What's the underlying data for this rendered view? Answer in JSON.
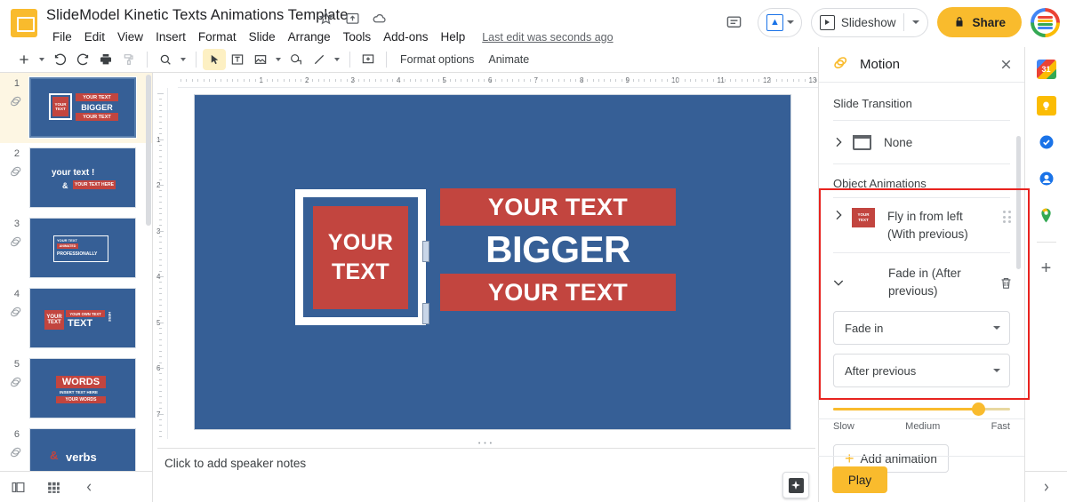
{
  "app": {
    "doc_title": "SlideModel Kinetic Texts Animations Template",
    "last_edit": "Last edit was seconds ago",
    "title_icons": [
      "star-icon",
      "move-to-folder-icon",
      "cloud-saved-icon"
    ]
  },
  "menus": [
    "File",
    "Edit",
    "View",
    "Insert",
    "Format",
    "Slide",
    "Arrange",
    "Tools",
    "Add-ons",
    "Help"
  ],
  "topright": {
    "comment_icon": "comment-icon",
    "present_icon": "present-icon",
    "slideshow_label": "Slideshow",
    "share_label": "Share",
    "share_lock_icon": "lock-icon",
    "avatar": "user-avatar"
  },
  "toolbar": {
    "new_slide_icon": "plus-icon",
    "undo_icon": "undo-icon",
    "redo_icon": "redo-icon",
    "print_icon": "print-icon",
    "paint_icon": "paint-format-icon",
    "zoom_icon": "zoom-icon",
    "select_icon": "select-cursor-icon",
    "textbox_icon": "text-box-icon",
    "image_icon": "image-icon",
    "shape_icon": "shape-icon",
    "line_icon": "line-icon",
    "comment_icon": "add-comment-icon",
    "format_options": "Format options",
    "animate": "Animate",
    "collapse_icon": "chevron-up-icon"
  },
  "ruler": {
    "horizontal": [
      "1",
      "2",
      "3",
      "4",
      "5",
      "6",
      "7",
      "8",
      "9",
      "10",
      "11",
      "12",
      "13"
    ],
    "vertical": [
      "1",
      "2",
      "3",
      "4",
      "5",
      "6",
      "7"
    ]
  },
  "filmstrip": {
    "slides": [
      {
        "num": "1",
        "selected": true,
        "badge": "animation-badge-icon",
        "kind": "s1"
      },
      {
        "num": "2",
        "selected": false,
        "badge": "animation-badge-icon",
        "kind": "s2",
        "line1": "your text !",
        "amp": "&",
        "tag": "YOUR TEXT HERE"
      },
      {
        "num": "3",
        "selected": false,
        "badge": "animation-badge-icon",
        "kind": "s3",
        "line1": "YOUR TEXT",
        "line2": "ANIMATED",
        "line3": "PROFESSIONALLY"
      },
      {
        "num": "4",
        "selected": false,
        "badge": "animation-badge-icon",
        "kind": "s4",
        "l1": "YOUR",
        "l2": "TEXT",
        "l3": "YOUR OWN TEXT",
        "l4": "TEXT",
        "l5": "HERE"
      },
      {
        "num": "5",
        "selected": false,
        "badge": "animation-badge-icon",
        "kind": "s5",
        "l1": "WORDS",
        "l2": "INSERT TEXT HERE",
        "l3": "YOUR WORDS"
      },
      {
        "num": "6",
        "selected": false,
        "badge": "animation-badge-icon",
        "kind": "s6",
        "amp": "&",
        "l1": "verbs"
      }
    ]
  },
  "slide": {
    "frame_box_line1": "YOUR",
    "frame_box_line2": "TEXT",
    "band1": "YOUR TEXT",
    "big": "BIGGER",
    "band3": "YOUR TEXT",
    "bg_color": "#365F96",
    "accent_color": "#C2453F"
  },
  "notes": {
    "placeholder": "Click to add speaker notes"
  },
  "bottombar": {
    "filmstrip_view_icon": "filmstrip-view-icon",
    "grid_view_icon": "grid-view-icon",
    "collapse_icon": "chevron-left-icon",
    "explore_icon": "explore-icon"
  },
  "motion_panel": {
    "icon": "motion-icon",
    "title": "Motion",
    "close_icon": "close-icon",
    "slide_transition_label": "Slide Transition",
    "transition_value": "None",
    "transition_icon": "slide-transition-icon",
    "object_animations_label": "Object Animations",
    "animations": [
      {
        "name": "Fly in from left",
        "trigger": "(With previous)",
        "expanded": false,
        "thumb_line1": "YOUR",
        "thumb_line2": "TEXT",
        "chevron": "chevron-right-icon",
        "drag_icon": "drag-handle-icon"
      },
      {
        "name": "Fade in",
        "trigger": "(After previous)",
        "label": "Fade in  (After previous)",
        "expanded": true,
        "chevron": "chevron-down-icon",
        "delete_icon": "trash-icon",
        "effect_select": "Fade in",
        "trigger_select": "After previous",
        "speed_slider": {
          "slow": "Slow",
          "medium": "Medium",
          "fast": "Fast",
          "value_pct": 82
        }
      }
    ],
    "add_animation_label": "Add animation",
    "play_label": "Play",
    "accent_color": "#F9BB2D",
    "annotation_color": "#e8231f"
  },
  "rail": {
    "items": [
      {
        "name": "calendar-icon",
        "glyph": "31"
      },
      {
        "name": "keep-icon",
        "glyph": ""
      },
      {
        "name": "tasks-icon",
        "glyph": ""
      },
      {
        "name": "contacts-icon",
        "glyph": ""
      },
      {
        "name": "maps-icon",
        "glyph": ""
      }
    ],
    "add_label": "+",
    "expand_icon": "chevron-right-icon"
  }
}
